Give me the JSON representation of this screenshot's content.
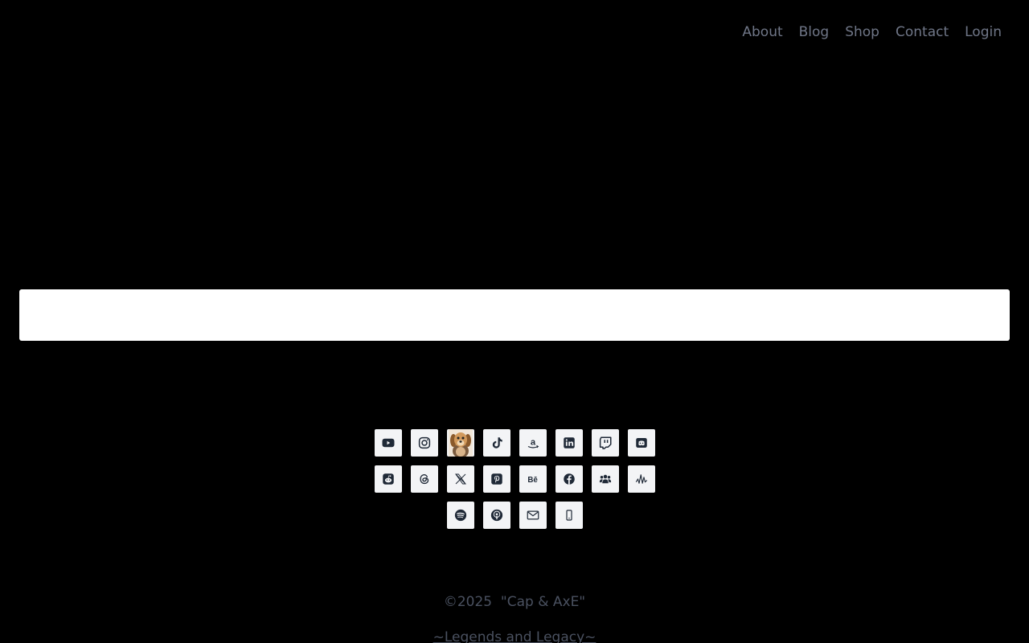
{
  "nav": {
    "items": [
      {
        "label": "About"
      },
      {
        "label": "Blog"
      },
      {
        "label": "Shop"
      },
      {
        "label": "Contact"
      },
      {
        "label": "Login"
      }
    ]
  },
  "social": {
    "rows": [
      [
        "youtube-icon",
        "instagram-icon",
        "avatar",
        "tiktok-icon",
        "amazon-icon",
        "linkedin-icon",
        "twitch-icon",
        "discord-icon"
      ],
      [
        "reddit-icon",
        "threads-icon",
        "x-icon",
        "pinterest-icon",
        "behance-icon",
        "facebook-icon",
        "group-icon",
        "podcast-icon"
      ],
      [
        "spotify-icon",
        "apple-podcasts-icon",
        "email-icon",
        "phone-icon"
      ]
    ]
  },
  "footer": {
    "copyright": "©2025  \"Cap & AxE\"",
    "tagline": "~Legends and Legacy~"
  },
  "colors": {
    "background": "#000000",
    "nav_text": "#6f7687",
    "banner": "#ffffff",
    "icon_tile": "#f3f4f6",
    "icon_glyph": "#1f2937",
    "footer_text": "#4a5160"
  }
}
